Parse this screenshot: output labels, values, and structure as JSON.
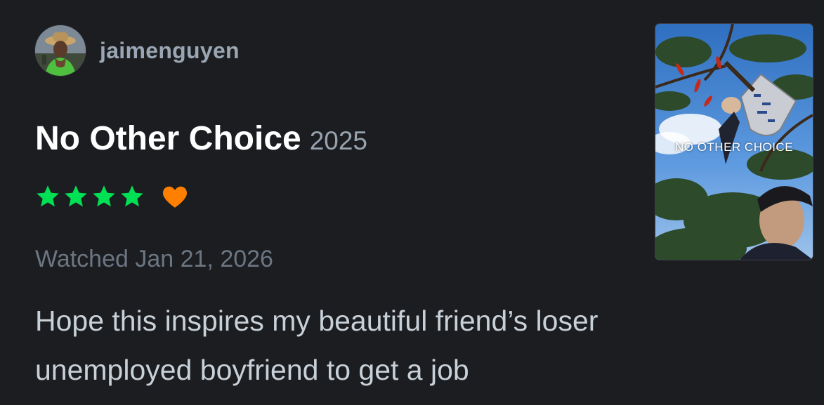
{
  "user": {
    "username": "jaimenguyen",
    "avatar_icon": "user-avatar-photo"
  },
  "film": {
    "title": "No Other Choice",
    "year": "2025",
    "poster_title": "NO OTHER CHOICE"
  },
  "rating": {
    "stars": 4,
    "max_stars": 5,
    "liked": true,
    "star_color": "#40bcf4",
    "star_fill": "#00e054",
    "heart_color": "#ff8000"
  },
  "watched_text": "Watched Jan 21, 2026",
  "review": {
    "text": "Hope this inspires my beautiful friend’s loser unemployed boyfriend to get a job"
  },
  "colors": {
    "background": "#1b1d21",
    "star_green": "#00e054",
    "heart_orange": "#ff8000"
  }
}
